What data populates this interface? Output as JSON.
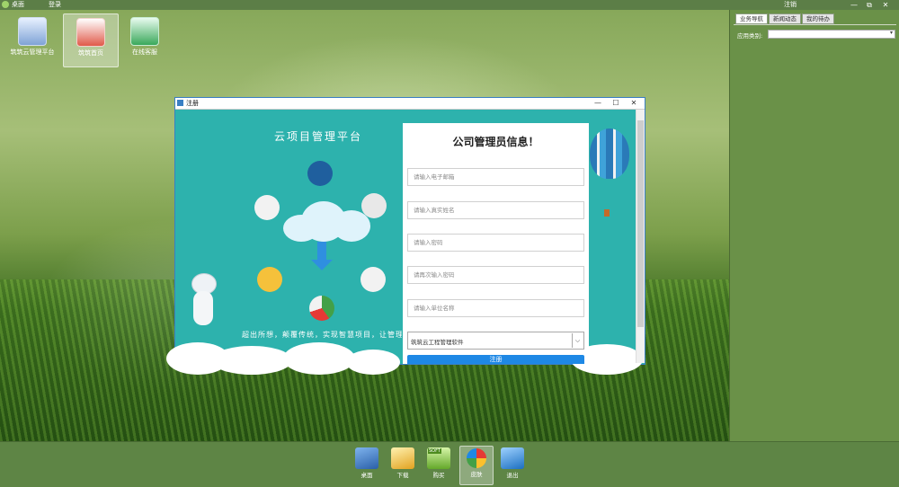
{
  "topbar": {
    "title": "桌面",
    "menu_login": "登录",
    "logout": "注销",
    "controls": {
      "minimize": "—",
      "restore": "⧉",
      "close": "✕"
    }
  },
  "desktop_icons": [
    {
      "label": "筑筑云管理平台",
      "icon": "monitor-icon",
      "selected": false
    },
    {
      "label": "筑筑首页",
      "icon": "home-icon",
      "selected": true
    },
    {
      "label": "在线客服",
      "icon": "phone-icon",
      "selected": false
    }
  ],
  "side_panel": {
    "tabs": [
      "业务导航",
      "新闻动态",
      "我的待办"
    ],
    "active_tab": 0,
    "category_label": "应用类别:",
    "category_value": ""
  },
  "taskbar": [
    {
      "label": "桌面",
      "icon": "desktop-icon",
      "selected": false
    },
    {
      "label": "下载",
      "icon": "folder-download-icon",
      "selected": false
    },
    {
      "label": "购买",
      "icon": "soft-buy-icon",
      "badge": "SOFT",
      "selected": false
    },
    {
      "label": "皮肤",
      "icon": "pie-skin-icon",
      "selected": true
    },
    {
      "label": "退出",
      "icon": "exit-car-icon",
      "selected": false
    }
  ],
  "dialog": {
    "title": "注册",
    "controls": {
      "minimize": "—",
      "maximize": "☐",
      "close": "✕"
    },
    "platform_title": "云项目管理平台",
    "slogan": "超出所想，颠覆传统，实现智慧项目，让管理更轻松",
    "form": {
      "heading": "公司管理员信息！",
      "email_placeholder": "请输入电子邮箱",
      "name_placeholder": "请输入真实姓名",
      "password_placeholder": "请输入密码",
      "password_confirm_placeholder": "请再次输入密码",
      "company_placeholder": "请输入单位名称",
      "software_value": "筑筑云工程管理软件",
      "submit_label": "注册"
    }
  },
  "colors": {
    "dialog_bg": "#2db2ad",
    "submit_blue": "#1e88e5",
    "panel_green": "#6a9148"
  }
}
